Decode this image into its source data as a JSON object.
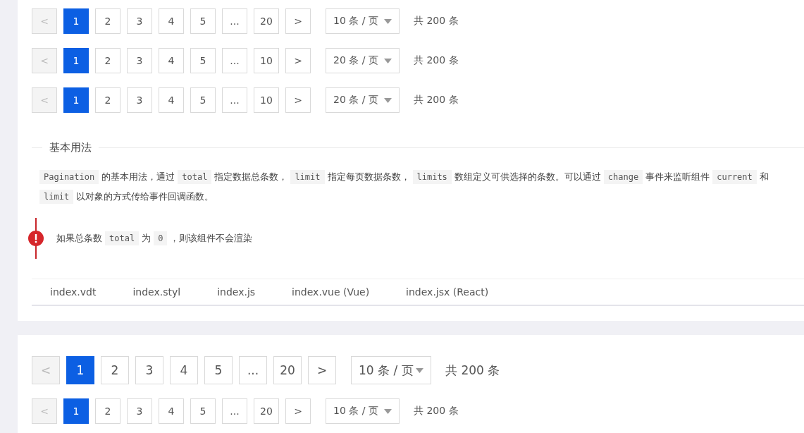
{
  "top_examples": [
    {
      "kind": "default",
      "prev": {
        "label": "<",
        "disabled": true
      },
      "pages": [
        {
          "label": "1",
          "selected": true
        },
        {
          "label": "2",
          "selected": false
        },
        {
          "label": "3",
          "selected": false
        },
        {
          "label": "4",
          "selected": false
        },
        {
          "label": "5",
          "selected": false
        },
        {
          "label": "...",
          "selected": false
        },
        {
          "label": "20",
          "selected": false
        }
      ],
      "next": {
        "label": ">",
        "disabled": false
      },
      "page_size": "10 条 / 页",
      "total": "共 200 条"
    },
    {
      "kind": "default",
      "prev": {
        "label": "<",
        "disabled": true
      },
      "pages": [
        {
          "label": "1",
          "selected": true
        },
        {
          "label": "2",
          "selected": false
        },
        {
          "label": "3",
          "selected": false
        },
        {
          "label": "4",
          "selected": false
        },
        {
          "label": "5",
          "selected": false
        },
        {
          "label": "...",
          "selected": false
        },
        {
          "label": "10",
          "selected": false
        }
      ],
      "next": {
        "label": ">",
        "disabled": false
      },
      "page_size": "20 条 / 页",
      "total": "共 200 条"
    },
    {
      "kind": "default",
      "prev": {
        "label": "<",
        "disabled": true
      },
      "pages": [
        {
          "label": "1",
          "selected": true
        },
        {
          "label": "2",
          "selected": false
        },
        {
          "label": "3",
          "selected": false
        },
        {
          "label": "4",
          "selected": false
        },
        {
          "label": "5",
          "selected": false
        },
        {
          "label": "...",
          "selected": false
        },
        {
          "label": "10",
          "selected": false
        }
      ],
      "next": {
        "label": ">",
        "disabled": false
      },
      "page_size": "20 条 / 页",
      "total": "共 200 条"
    }
  ],
  "section_title": "基本用法",
  "description": [
    {
      "kind": "code",
      "text": "Pagination"
    },
    {
      "kind": "text",
      "text": "的基本用法，通过"
    },
    {
      "kind": "code",
      "text": "total"
    },
    {
      "kind": "text",
      "text": "指定数据总条数，"
    },
    {
      "kind": "code",
      "text": "limit"
    },
    {
      "kind": "text",
      "text": "指定每页数据条数，"
    },
    {
      "kind": "code",
      "text": "limits"
    },
    {
      "kind": "text",
      "text": "数组定义可供选择的条数。可以通过"
    },
    {
      "kind": "code",
      "text": "change"
    },
    {
      "kind": "text",
      "text": "事件来监听组件"
    },
    {
      "kind": "code",
      "text": "current"
    },
    {
      "kind": "text",
      "text": "和"
    },
    {
      "kind": "code",
      "text": "limit"
    },
    {
      "kind": "text",
      "text": "以对象的方式传给事件回调函数。"
    }
  ],
  "alert": [
    {
      "kind": "text",
      "text": "如果总条数"
    },
    {
      "kind": "code",
      "text": "total"
    },
    {
      "kind": "text",
      "text": "为"
    },
    {
      "kind": "code",
      "text": "0"
    },
    {
      "kind": "text",
      "text": "，则该组件不会渲染"
    }
  ],
  "code_tabs": [
    {
      "label": "index.vdt",
      "selected": false
    },
    {
      "label": "index.styl",
      "selected": false
    },
    {
      "label": "index.js",
      "selected": false
    },
    {
      "label": "index.vue (Vue)",
      "selected": false
    },
    {
      "label": "index.jsx (React)",
      "selected": false
    }
  ],
  "bottom_examples": [
    {
      "kind": "large",
      "prev": {
        "label": "<",
        "disabled": true
      },
      "pages": [
        {
          "label": "1",
          "selected": true
        },
        {
          "label": "2",
          "selected": false
        },
        {
          "label": "3",
          "selected": false
        },
        {
          "label": "4",
          "selected": false
        },
        {
          "label": "5",
          "selected": false
        },
        {
          "label": "...",
          "selected": false
        },
        {
          "label": "20",
          "selected": false
        }
      ],
      "next": {
        "label": ">",
        "disabled": false
      },
      "page_size": "10 条 / 页",
      "total": "共 200 条"
    },
    {
      "kind": "default",
      "prev": {
        "label": "<",
        "disabled": true
      },
      "pages": [
        {
          "label": "1",
          "selected": true
        },
        {
          "label": "2",
          "selected": false
        },
        {
          "label": "3",
          "selected": false
        },
        {
          "label": "4",
          "selected": false
        },
        {
          "label": "5",
          "selected": false
        },
        {
          "label": "...",
          "selected": false
        },
        {
          "label": "20",
          "selected": false
        }
      ],
      "next": {
        "label": ">",
        "disabled": false
      },
      "page_size": "10 条 / 页",
      "total": "共 200 条"
    }
  ]
}
